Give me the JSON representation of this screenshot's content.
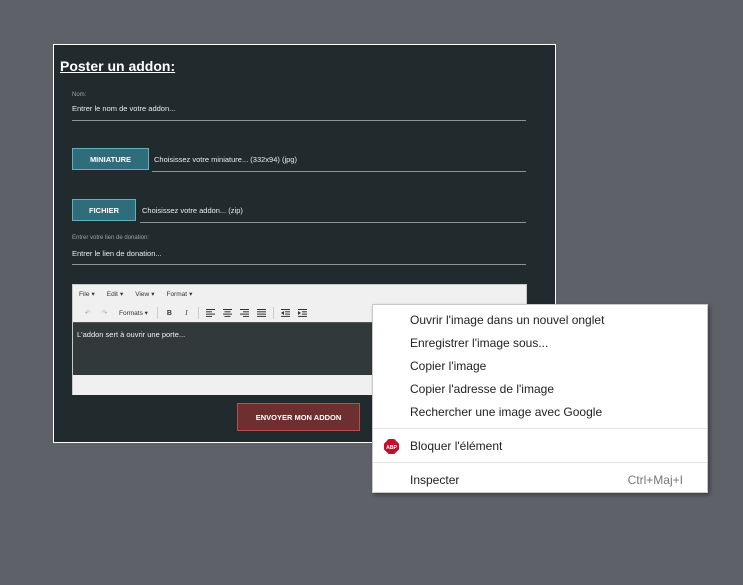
{
  "form": {
    "title": "Poster un addon:",
    "name_label": "Nom:",
    "name_placeholder": "Entrer le nom de votre addon...",
    "thumbnail_button": "MINIATURE",
    "thumbnail_hint": "Choisissez votre miniature... (332x94) (jpg)",
    "file_button": "FICHIER",
    "file_hint": "Choisissez votre addon... (zip)",
    "donation_label": "Entrer votre lien de donation:",
    "donation_placeholder": "Entrer le lien de donation...",
    "submit_button": "ENVOYER MON ADDON"
  },
  "editor": {
    "menu": [
      "File",
      "Edit",
      "View",
      "Format"
    ],
    "formats_label": "Formats",
    "bold": "B",
    "italic": "I",
    "content": "L'addon sert à ouvrir une porte..."
  },
  "context_menu": {
    "items": [
      "Ouvrir l'image dans un nouvel onglet",
      "Enregistrer l'image sous...",
      "Copier l'image",
      "Copier l'adresse de l'image",
      "Rechercher une image avec Google"
    ],
    "block_element": "Bloquer l'élément",
    "abp_badge": "ABP",
    "inspect": "Inspecter",
    "inspect_shortcut": "Ctrl+Maj+I"
  }
}
